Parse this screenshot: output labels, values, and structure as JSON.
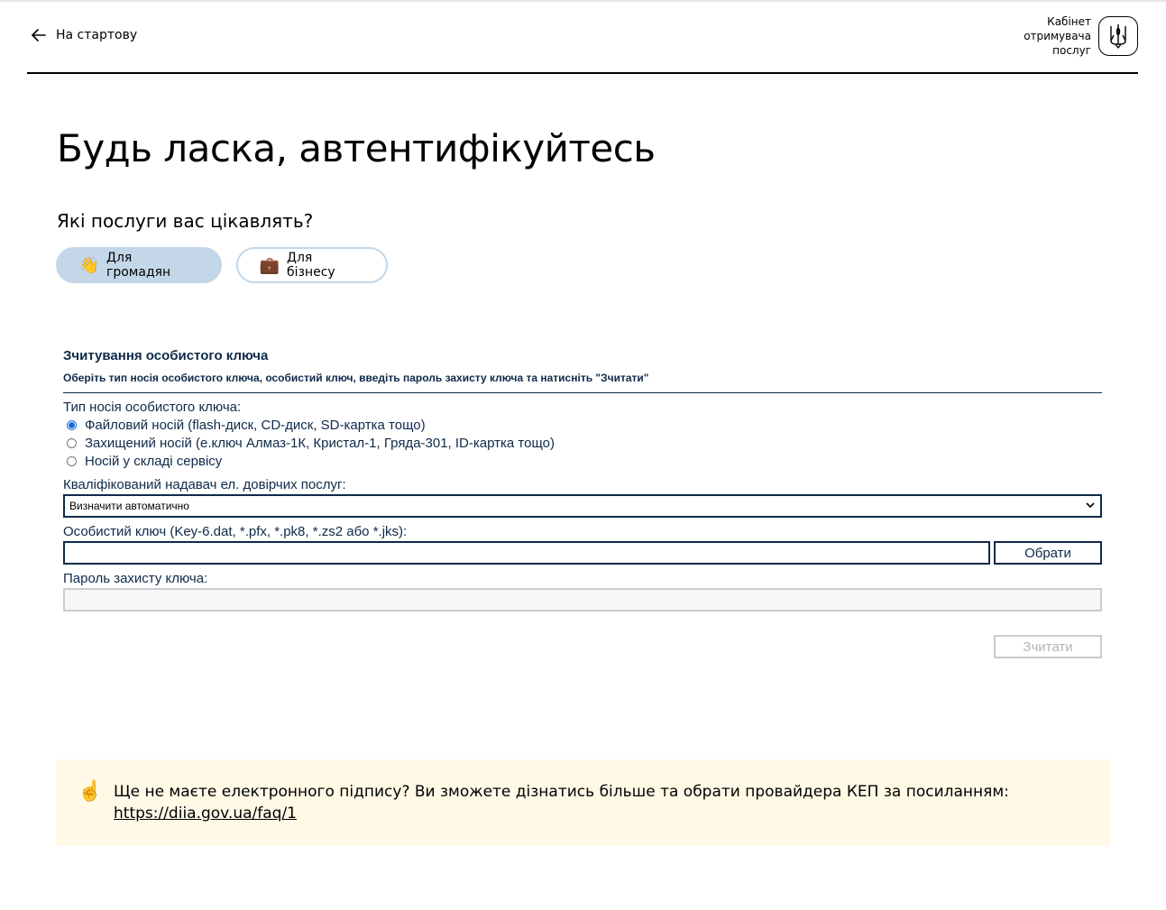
{
  "header": {
    "back_label": "На стартову",
    "cabinet_line1": "Кабінет",
    "cabinet_line2": "отримувача",
    "cabinet_line3": "послуг"
  },
  "page_title": "Будь ласка, автентифікуйтесь",
  "services": {
    "question": "Які послуги вас цікавлять?",
    "options": [
      {
        "label": "Для громадян",
        "emoji": "👋",
        "selected": true
      },
      {
        "label": "Для бізнесу",
        "emoji": "💼",
        "selected": false
      }
    ]
  },
  "key_form": {
    "title": "Зчитування особистого ключа",
    "subtitle": "Оберіть тип носія особистого ключа, особистий ключ, введіть пароль захисту ключа та натисніть \"Зчитати\"",
    "carrier_label": "Тип носія особистого ключа:",
    "carrier_options": [
      {
        "label": "Файловий носій (flash-диск, CD-диск, SD-картка тощо)",
        "checked": true
      },
      {
        "label": "Захищений носій (е.ключ Алмаз-1К, Кристал-1, Гряда-301, ID-картка тощо)",
        "checked": false
      },
      {
        "label": "Носій у складі сервісу",
        "checked": false
      }
    ],
    "provider_label": "Кваліфікований надавач ел. довірчих послуг:",
    "provider_value": "Визначити автоматично",
    "key_label": "Особистий ключ (Key-6.dat, *.pfx, *.pk8, *.zs2 або *.jks):",
    "key_value": "",
    "browse_label": "Обрати",
    "password_label": "Пароль захисту ключа:",
    "password_value": "",
    "read_label": "Зчитати"
  },
  "note": {
    "icon": "pointing-up-hand-icon",
    "text": "Ще не маєте електронного підпису? Ви зможете дізнатись більше та обрати провайдера КЕП за посиланням:",
    "link": "https://diia.gov.ua/faq/1"
  },
  "colors": {
    "accent_pill": "#c3d7e8",
    "form_text": "#0e2a4a",
    "radio_checked": "#1a6ed8",
    "note_background": "#fff9e6"
  }
}
